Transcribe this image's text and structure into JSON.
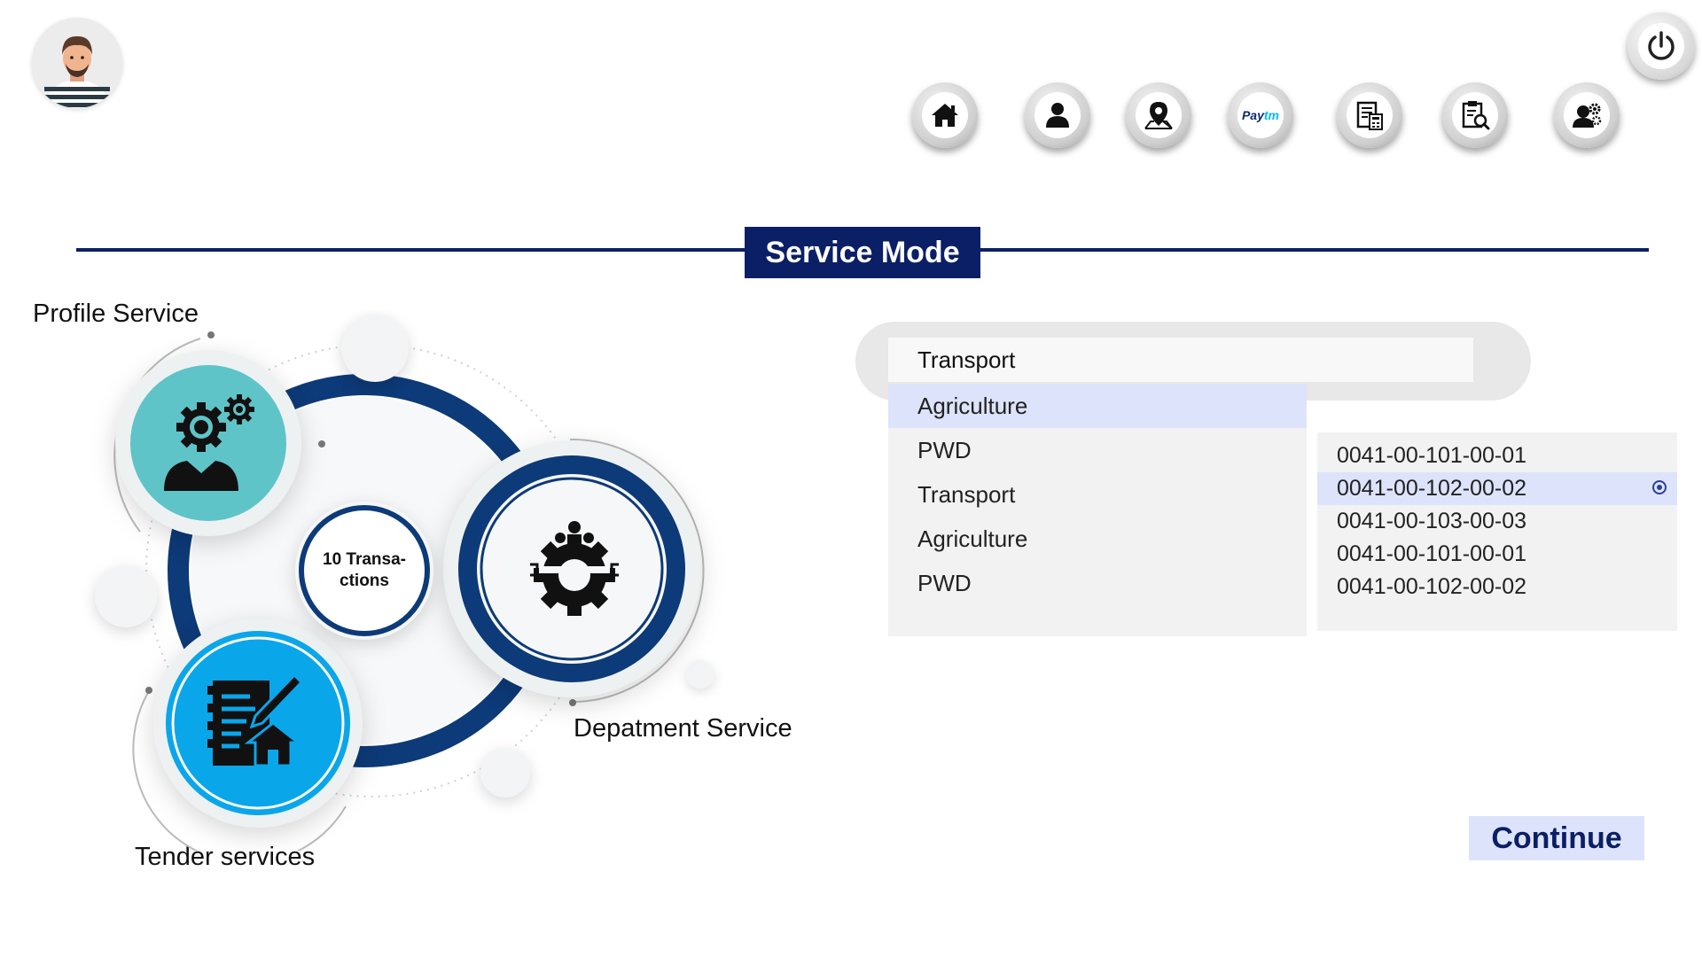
{
  "header": {
    "avatar_icon": "user-avatar-icon",
    "power_icon": "power-icon",
    "nav": [
      {
        "icon": "home-icon"
      },
      {
        "icon": "user-icon"
      },
      {
        "icon": "map-location-icon"
      },
      {
        "icon": "paytm-icon",
        "text": "Paytm"
      },
      {
        "icon": "document-calculator-icon"
      },
      {
        "icon": "clipboard-search-icon"
      },
      {
        "icon": "user-settings-icon"
      }
    ]
  },
  "section": {
    "title": "Service Mode"
  },
  "diagram": {
    "profile_label": "Profile Service",
    "department_label": "Depatment Service",
    "tender_label": "Tender services",
    "center_text": "10 Transa-ctions",
    "center_line1": "10 Transa-",
    "center_line2": "ctions",
    "colors": {
      "navy": "#0d3a78",
      "teal": "#5ec4c8",
      "blue": "#0aa6ea"
    }
  },
  "dropdown": {
    "selected_value": "Transport",
    "options": [
      "Agriculture",
      "PWD",
      "Transport",
      "Agriculture",
      "PWD"
    ],
    "highlighted_index": 0
  },
  "accounts": {
    "options": [
      "0041-00-101-00-01",
      "0041-00-102-00-02",
      "0041-00-103-00-03",
      "0041-00-101-00-01",
      "0041-00-102-00-02"
    ],
    "selected_index": 1
  },
  "actions": {
    "continue_label": "Continue"
  },
  "colors": {
    "primary": "#0b1f66",
    "highlight": "#dde3fa",
    "panel": "#f2f2f2"
  }
}
